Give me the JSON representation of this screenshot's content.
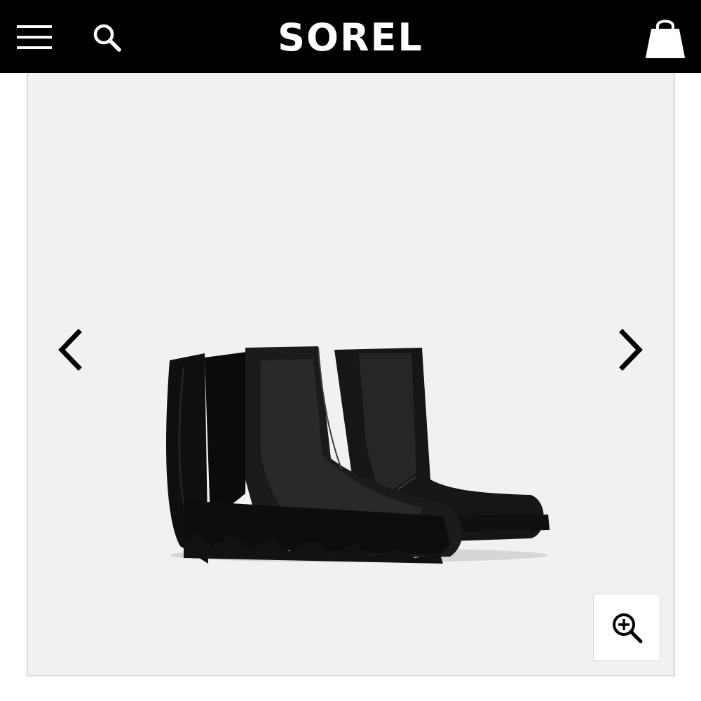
{
  "header": {
    "brand": "SOREL",
    "background": "#000000",
    "icons": {
      "menu": "hamburger-menu-icon",
      "search": "search-icon",
      "cart": "shopping-bag-icon"
    }
  },
  "gallery": {
    "background": "#f1f1f1",
    "image": "black-chelsea-wedge-boots",
    "controls": {
      "prev": "chevron-left-icon",
      "next": "chevron-right-icon",
      "zoom": "zoom-in-icon"
    }
  }
}
